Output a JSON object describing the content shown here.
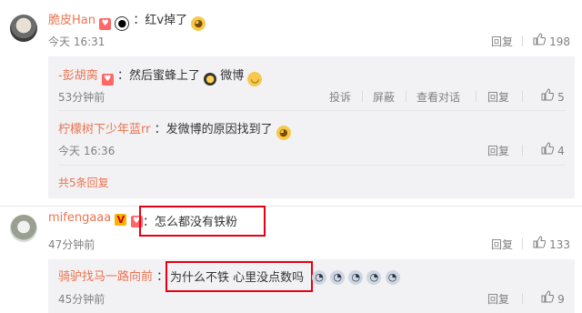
{
  "comments": [
    {
      "user": "脆皮Han",
      "text": "：红v掉了",
      "time": "今天 16:31",
      "reply_label": "回复",
      "likes": "198",
      "replies": [
        {
          "user": "-彭胡脔",
          "text": "：然后蜜蜂上了",
          "text2": "微博",
          "time": "53分钟前",
          "actions": [
            "投诉",
            "屏蔽",
            "查看对话",
            "回复"
          ],
          "likes": "5"
        },
        {
          "user": "柠檬树下少年蓝rr",
          "text": "：发微博的原因找到了",
          "time": "今天 16:36",
          "actions": [
            "回复"
          ],
          "likes": "4"
        }
      ],
      "more_replies": "共5条回复"
    },
    {
      "user": "mifengaaa",
      "text": "：怎么都没有铁粉",
      "time": "47分钟前",
      "reply_label": "回复",
      "likes": "133",
      "replies": [
        {
          "user": "骑驴找马一路向前",
          "text": "：",
          "text_highlight": "为什么不铁  心里没点数吗",
          "time": "45分钟前",
          "actions": [
            "回复"
          ],
          "likes": "9"
        }
      ]
    }
  ],
  "icons": {
    "badge": "heart-badge",
    "vip": "orange-v-badge",
    "emoji_dog": "doge-emoji",
    "emoji_panda": "panda-emoji",
    "emoji_bee": "bee-emoji",
    "emoji_laugh": "laughing-emoji",
    "emoji_cry": "crying-emoji",
    "like": "thumbs-up-icon"
  },
  "colors": {
    "username": "#eb7350",
    "highlight_box": "#e60012",
    "reply_bg": "#f2f2f5"
  }
}
